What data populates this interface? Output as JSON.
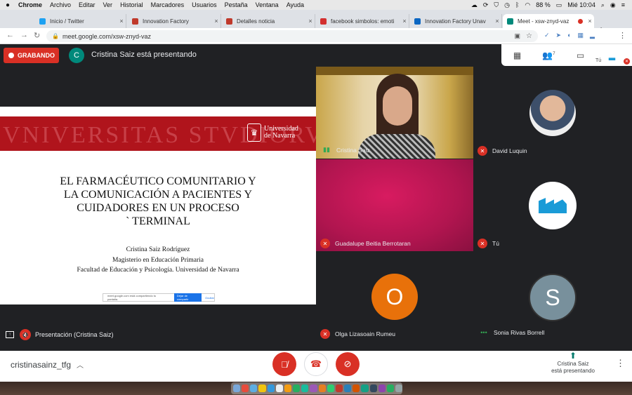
{
  "menubar": {
    "apple": "",
    "items": [
      "Chrome",
      "Archivo",
      "Editar",
      "Ver",
      "Historial",
      "Marcadores",
      "Usuarios",
      "Pestaña",
      "Ventana",
      "Ayuda"
    ],
    "battery": "88 %",
    "clock": "Mié 10:04"
  },
  "tabs": [
    {
      "title": "Inicio / Twitter",
      "favicon_color": "#1da1f2"
    },
    {
      "title": "Innovation Factory",
      "favicon_color": "#c0392b"
    },
    {
      "title": "Detalles noticia",
      "favicon_color": "#c0392b"
    },
    {
      "title": "facebook simbolos: emoti",
      "favicon_color": "#d32f2f"
    },
    {
      "title": "Innovation Factory Unav",
      "favicon_color": "#0a66c2"
    },
    {
      "title": "Meet - xsw-znyd-vaz",
      "favicon_color": "#00897b"
    }
  ],
  "tab_close_label": "×",
  "newtab_label": "+",
  "address": {
    "url": "meet.google.com/xsw-znyd-vaz"
  },
  "meet": {
    "recording_label": "GRABANDO",
    "presenter_initial": "C",
    "presenter_text": "Cristina Saiz está presentando",
    "you_label": "Tú",
    "people_count": "7",
    "slide": {
      "watermark": "VNIVERSITAS STVDIORVM",
      "university_line1": "Universidad",
      "university_line2": "de Navarra",
      "title_lines": [
        "EL FARMACÉUTICO COMUNITARIO Y",
        "LA COMUNICACIÓN A PACIENTES Y",
        "CUIDADORES EN UN PROCESO",
        "` TERMINAL"
      ],
      "author_lines": [
        "Cristina Saiz Rodríguez",
        "Magisterio en Educación Primaria",
        "Facultad de Educación y Psicología. Universidad de Navarra"
      ],
      "share_text": "meet.google.com está compartiendo tu pantalla.",
      "share_stop": "Dejar de compartir",
      "share_hide": "Ocultar"
    },
    "presentation_label": "Presentación (Cristina Saiz)",
    "participants": [
      {
        "name": "Cristina Saiz",
        "mic": "live"
      },
      {
        "name": "David Luquin",
        "mic": "off"
      },
      {
        "name": "Guadalupe Beitia Berrotaran",
        "mic": "off"
      },
      {
        "name": "Tú",
        "mic": "off"
      },
      {
        "name": "Olga Lizasoain Rumeu",
        "mic": "off",
        "initial": "O",
        "color": "#e8710a"
      },
      {
        "name": "Sonia Rivas Borrell",
        "mic": "dots",
        "initial": "S",
        "color": "#78909c"
      }
    ]
  },
  "bottom": {
    "meeting_code": "cristinasainz_tfg",
    "presenting_line1": "Cristina Saiz",
    "presenting_line2": "está presentando"
  },
  "colors": {
    "accent_red": "#d93025",
    "meet_bg": "#202124",
    "slide_red": "#b0141c"
  }
}
